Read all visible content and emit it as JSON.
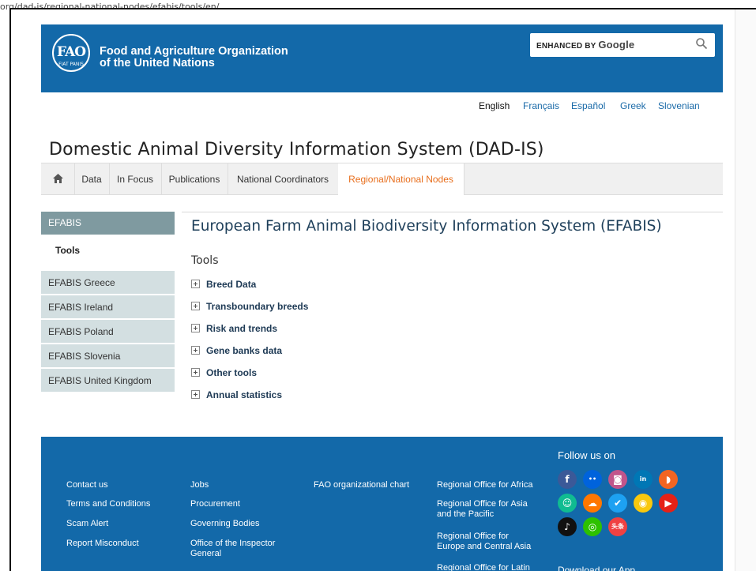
{
  "url": "org/dad-is/regional-national-nodes/efabis/tools/en/",
  "header": {
    "logo_text": "FAO",
    "logo_motto": "FIAT PANIS",
    "org_line1": "Food and Agriculture Organization",
    "org_line2": "of the United Nations",
    "search_label": "ENHANCED BY",
    "search_brand": "Google"
  },
  "languages": [
    "English",
    "Français",
    "Español",
    "Greek",
    "Slovenian"
  ],
  "site_title": "Domestic Animal Diversity Information System (DAD-IS)",
  "nav": [
    "Data",
    "In Focus",
    "Publications",
    "National Coordinators",
    "Regional/National Nodes"
  ],
  "sidebar": {
    "head": "EFABIS",
    "active": "Tools",
    "items": [
      "EFABIS Greece",
      "EFABIS Ireland",
      "EFABIS Poland",
      "EFABIS Slovenia",
      "EFABIS United Kingdom"
    ]
  },
  "main": {
    "title": "European Farm Animal Biodiversity Information System (EFABIS)",
    "section": "Tools",
    "tools": [
      "Breed Data",
      "Transboundary breeds",
      "Risk and trends",
      "Gene banks data",
      "Other tools",
      "Annual statistics"
    ]
  },
  "footer": {
    "col1": [
      "Contact us",
      "Terms and Conditions",
      "Scam Alert",
      "Report Misconduct"
    ],
    "col2": [
      "Jobs",
      "Procurement",
      "Governing Bodies",
      "Office of the Inspector General"
    ],
    "col3": [
      "FAO organizational chart"
    ],
    "col4": [
      "Regional Office for Africa",
      "Regional Office for Asia and the Pacific",
      "Regional Office for Europe and Central Asia",
      "Regional Office for Latin"
    ],
    "follow": "Follow us on",
    "download": "Download our App",
    "social": [
      {
        "name": "facebook",
        "glyph": "f",
        "color": "#3b5998"
      },
      {
        "name": "flickr",
        "glyph": "••",
        "color": "#0063dc"
      },
      {
        "name": "instagram",
        "glyph": "◙",
        "color": "#c1558b"
      },
      {
        "name": "linkedin",
        "glyph": "in",
        "color": "#0077b5"
      },
      {
        "name": "rss",
        "glyph": "◗",
        "color": "#f26522"
      },
      {
        "name": "slideshare",
        "glyph": "☺",
        "color": "#10bc91"
      },
      {
        "name": "soundcloud",
        "glyph": "☁",
        "color": "#ff7700"
      },
      {
        "name": "twitter",
        "glyph": "✔",
        "color": "#1da1f2"
      },
      {
        "name": "weibo",
        "glyph": "◉",
        "color": "#f9c80e"
      },
      {
        "name": "youtube",
        "glyph": "▶",
        "color": "#e62117"
      },
      {
        "name": "tiktok",
        "glyph": "♪",
        "color": "#111111"
      },
      {
        "name": "wechat",
        "glyph": "◎",
        "color": "#2dc100"
      },
      {
        "name": "toutiao",
        "glyph": "头条",
        "color": "#f04142"
      }
    ]
  }
}
